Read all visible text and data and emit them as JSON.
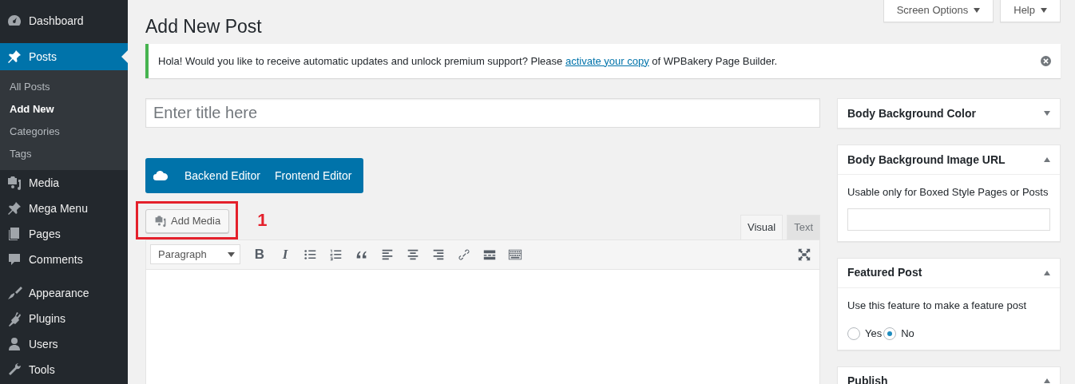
{
  "sidebar": {
    "groups": [
      [
        {
          "label": "Dashboard",
          "selected": false
        },
        {
          "label": "Posts",
          "selected": true,
          "children": [
            {
              "label": "All Posts",
              "selected": false
            },
            {
              "label": "Add New",
              "selected": true
            },
            {
              "label": "Categories",
              "selected": false
            },
            {
              "label": "Tags",
              "selected": false
            }
          ]
        },
        {
          "label": "Media",
          "selected": false
        },
        {
          "label": "Mega Menu",
          "selected": false
        },
        {
          "label": "Pages",
          "selected": false
        },
        {
          "label": "Comments",
          "selected": false
        }
      ],
      [
        {
          "label": "Appearance",
          "selected": false
        },
        {
          "label": "Plugins",
          "selected": false
        },
        {
          "label": "Users",
          "selected": false
        },
        {
          "label": "Tools",
          "selected": false
        }
      ]
    ]
  },
  "screen_tabs": [
    "Screen Options",
    "Help"
  ],
  "page_title": "Add New Post",
  "notice": {
    "before": "Hola! Would you like to receive automatic updates and unlock premium support? Please ",
    "link": "activate your copy",
    "after": " of WPBakery Page Builder."
  },
  "title_field": {
    "placeholder": "Enter title here"
  },
  "builder_buttons": [
    "Backend Editor",
    "Frontend Editor"
  ],
  "add_media": {
    "label": "Add Media"
  },
  "annotation": {
    "number": "1"
  },
  "editor_tabs": [
    {
      "label": "Visual",
      "selected": true
    },
    {
      "label": "Text",
      "selected": false
    }
  ],
  "toolbar": {
    "format": "Paragraph",
    "bold": "B",
    "italic": "I"
  },
  "meta_boxes": [
    {
      "kind": "plain",
      "title": "Body Background Color",
      "expanded": false
    },
    {
      "kind": "field",
      "title": "Body Background Image URL",
      "expanded": true,
      "description": "Usable only for Boxed Style Pages or Posts"
    },
    {
      "kind": "radio",
      "title": "Featured Post",
      "expanded": true,
      "description": "Use this feature to make a feature post",
      "options": [
        {
          "label": "Yes",
          "selected": false
        },
        {
          "label": "No",
          "selected": true
        }
      ]
    },
    {
      "kind": "plain",
      "title": "Publish",
      "expanded": true
    }
  ]
}
